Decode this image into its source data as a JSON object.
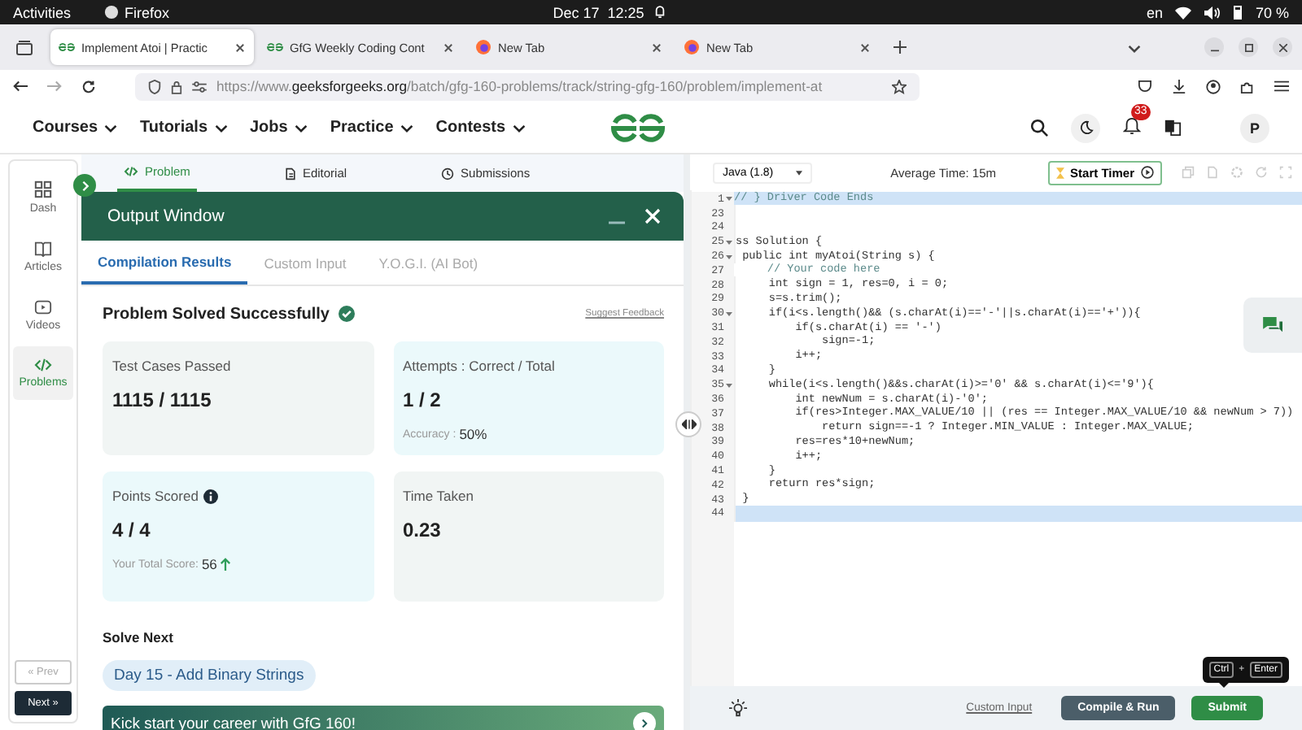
{
  "os_bar": {
    "activities": "Activities",
    "app": "Firefox",
    "clock": "Dec 17  12:25",
    "input_source": "en",
    "battery": "70 %"
  },
  "browser": {
    "tabs": [
      {
        "title": "Implement Atoi | Practic",
        "kind": "gfg",
        "selected": true
      },
      {
        "title": "GfG Weekly Coding Cont",
        "kind": "gfg",
        "selected": false
      },
      {
        "title": "New Tab",
        "kind": "firefox",
        "selected": false
      },
      {
        "title": "New Tab",
        "kind": "firefox",
        "selected": false
      }
    ],
    "url": {
      "scheme": "https://www.",
      "domain": "geeksforgeeks.org",
      "path": "/batch/gfg-160-problems/track/string-gfg-160/problem/implement-at"
    }
  },
  "site_nav": {
    "menus": [
      "Courses",
      "Tutorials",
      "Jobs",
      "Practice",
      "Contests"
    ],
    "notification_count": "33",
    "avatar": "P"
  },
  "sidebar": {
    "items": [
      {
        "label": "Dash",
        "kind": "dash",
        "selected": false
      },
      {
        "label": "Articles",
        "kind": "articles",
        "selected": false
      },
      {
        "label": "Videos",
        "kind": "videos",
        "selected": false
      },
      {
        "label": "Problems",
        "kind": "problems",
        "selected": true
      }
    ],
    "prev": {
      "label": "« Prev",
      "disabled": true
    },
    "next": {
      "label": "Next »"
    }
  },
  "problem_tabs": [
    {
      "label": "Problem",
      "kind": "code",
      "selected": true
    },
    {
      "label": "Editorial",
      "kind": "document",
      "selected": false
    },
    {
      "label": "Submissions",
      "kind": "clock",
      "selected": false
    }
  ],
  "output_window": {
    "title": "Output Window",
    "tabs": [
      {
        "label": "Compilation Results",
        "selected": true
      },
      {
        "label": "Custom Input",
        "selected": false
      },
      {
        "label": "Y.O.G.I. (AI Bot)",
        "selected": false
      }
    ],
    "status": "Problem Solved Successfully",
    "feedback_link": "Suggest Feedback",
    "cards": [
      {
        "label": "Test Cases Passed",
        "value": "1115 / 1115",
        "color": "#f1f5f4"
      },
      {
        "label": "Attempts : Correct / Total",
        "value": "1 / 2",
        "note_label": "Accuracy : ",
        "note_value": "50%",
        "color": "#ebf9fb"
      },
      {
        "label": "Points Scored",
        "info": true,
        "value": "4 / 4",
        "note_label": "Your Total Score: ",
        "note_value": "56",
        "rising": true,
        "color": "#ebf9fb"
      },
      {
        "label": "Time Taken",
        "value": "0.23",
        "color": "#f1f5f4"
      }
    ],
    "solve_next": {
      "heading": "Solve Next",
      "problem": "Day 15 - Add Binary Strings"
    },
    "banner": "Kick start your career with GfG 160!"
  },
  "editor": {
    "language": "Java (1.8)",
    "average_time": "Average Time: 15m",
    "timer_button": "Start Timer",
    "lines": [
      {
        "number": "1",
        "text": "// } Driver Code Ends",
        "kind": "comment",
        "foldable": true,
        "highlighted": true
      },
      {
        "number": "23",
        "kind": "code",
        "foldable": false,
        "highlighted": false
      },
      {
        "number": "24",
        "kind": "code",
        "foldable": false,
        "highlighted": false
      },
      {
        "number": "25",
        "text": "ss Solution {",
        "kind": "code",
        "foldable": true,
        "highlighted": false
      },
      {
        "number": "26",
        "text": " public int myAtoi(String s) {",
        "kind": "code",
        "foldable": true,
        "highlighted": false
      },
      {
        "number": "27",
        "text": "     // Your code here",
        "kind": "comment",
        "foldable": false,
        "highlighted": false
      },
      {
        "number": "28",
        "text": "     int sign = 1, res=0, i = 0;",
        "kind": "code",
        "foldable": false,
        "highlighted": false
      },
      {
        "number": "29",
        "text": "     s=s.trim();",
        "kind": "code",
        "foldable": false,
        "highlighted": false
      },
      {
        "number": "30",
        "text": "     if(i<s.length()&& (s.charAt(i)=='-'||s.charAt(i)=='+')){",
        "kind": "code",
        "foldable": true,
        "highlighted": false
      },
      {
        "number": "31",
        "text": "         if(s.charAt(i) == '-')",
        "kind": "code",
        "foldable": false,
        "highlighted": false
      },
      {
        "number": "32",
        "text": "             sign=-1;",
        "kind": "code",
        "foldable": false,
        "highlighted": false
      },
      {
        "number": "33",
        "text": "         i++;",
        "kind": "code",
        "foldable": false,
        "highlighted": false
      },
      {
        "number": "34",
        "text": "     }",
        "kind": "code",
        "foldable": false,
        "highlighted": false
      },
      {
        "number": "35",
        "text": "     while(i<s.length()&&s.charAt(i)>='0' && s.charAt(i)<='9'){",
        "kind": "code",
        "foldable": true,
        "highlighted": false
      },
      {
        "number": "36",
        "text": "         int newNum = s.charAt(i)-'0';",
        "kind": "code",
        "foldable": false,
        "highlighted": false
      },
      {
        "number": "37",
        "text": "         if(res>Integer.MAX_VALUE/10 || (res == Integer.MAX_VALUE/10 && newNum > 7))",
        "kind": "code",
        "foldable": false,
        "highlighted": false
      },
      {
        "number": "38",
        "text": "             return sign==-1 ? Integer.MIN_VALUE : Integer.MAX_VALUE;",
        "kind": "code",
        "foldable": false,
        "highlighted": false
      },
      {
        "number": "39",
        "text": "         res=res*10+newNum;",
        "kind": "code",
        "foldable": false,
        "highlighted": false
      },
      {
        "number": "40",
        "text": "         i++;",
        "kind": "code",
        "foldable": false,
        "highlighted": false
      },
      {
        "number": "41",
        "text": "     }",
        "kind": "code",
        "foldable": false,
        "highlighted": false
      },
      {
        "number": "42",
        "text": "     return res*sign;",
        "kind": "code",
        "foldable": false,
        "highlighted": false
      },
      {
        "number": "43",
        "text": " }",
        "kind": "code",
        "foldable": false,
        "highlighted": false
      },
      {
        "number": "44",
        "kind": "code",
        "foldable": false,
        "highlighted": true
      }
    ],
    "custom_input_link": "Custom Input",
    "compile_button": "Compile & Run",
    "submit_button": "Submit",
    "shortcut": {
      "keys": [
        "Ctrl",
        "Enter"
      ],
      "separator": "+"
    }
  }
}
